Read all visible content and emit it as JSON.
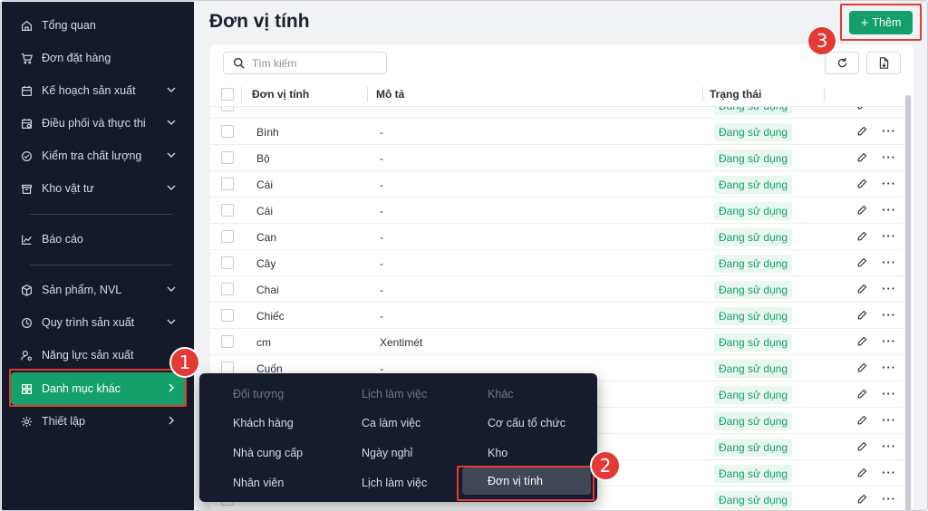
{
  "sidebar": {
    "items": [
      {
        "label": "Tổng quan",
        "icon": "home-icon"
      },
      {
        "label": "Đơn đặt hàng",
        "icon": "cart-icon"
      },
      {
        "label": "Kế hoạch sản xuất",
        "icon": "calendar-plan-icon"
      },
      {
        "label": "Điều phối và thực thi",
        "icon": "calendar-run-icon"
      },
      {
        "label": "Kiểm tra chất lượng",
        "icon": "check-circle-icon"
      },
      {
        "label": "Kho vật tư",
        "icon": "warehouse-icon"
      },
      {
        "label": "Báo cáo",
        "icon": "chart-icon"
      },
      {
        "label": "Sản phẩm, NVL",
        "icon": "box-icon"
      },
      {
        "label": "Quy trình sản xuất",
        "icon": "process-icon"
      },
      {
        "label": "Năng lực sản xuất",
        "icon": "capacity-icon"
      },
      {
        "label": "Danh mục khác",
        "icon": "grid-icon"
      },
      {
        "label": "Thiết lập",
        "icon": "gear-icon"
      }
    ]
  },
  "callouts": {
    "one": "1",
    "two": "2",
    "three": "3"
  },
  "header": {
    "title": "Đơn vị tính",
    "add_label": "Thêm"
  },
  "toolbar": {
    "search_placeholder": "Tìm kiếm"
  },
  "table": {
    "headers": {
      "name": "Đơn vị tính",
      "desc": "Mô tả",
      "status": "Trạng thái"
    },
    "rows": [
      {
        "name": "",
        "desc": "",
        "status": "Đang sử dụng"
      },
      {
        "name": "Bình",
        "desc": "-",
        "status": "Đang sử dụng"
      },
      {
        "name": "Bộ",
        "desc": "-",
        "status": "Đang sử dụng"
      },
      {
        "name": "Cái",
        "desc": "-",
        "status": "Đang sử dụng"
      },
      {
        "name": "Cái",
        "desc": "-",
        "status": "Đang sử dụng"
      },
      {
        "name": "Can",
        "desc": "-",
        "status": "Đang sử dụng"
      },
      {
        "name": "Cây",
        "desc": "-",
        "status": "Đang sử dụng"
      },
      {
        "name": "Chai",
        "desc": "-",
        "status": "Đang sử dụng"
      },
      {
        "name": "Chiếc",
        "desc": "-",
        "status": "Đang sử dụng"
      },
      {
        "name": "cm",
        "desc": "Xentimét",
        "status": "Đang sử dụng"
      },
      {
        "name": "Cuốn",
        "desc": "-",
        "status": "Đang sử dụng"
      },
      {
        "name": "",
        "desc": "",
        "status": "Đang sử dụng"
      },
      {
        "name": "",
        "desc": "",
        "status": "Đang sử dụng"
      },
      {
        "name": "",
        "desc": "",
        "status": "Đang sử dụng"
      },
      {
        "name": "",
        "desc": "",
        "status": "Đang sử dụng"
      },
      {
        "name": "",
        "desc": "",
        "status": "Đang sử dụng"
      }
    ]
  },
  "dropdown": {
    "columns": [
      {
        "header": "Đối tượng",
        "items": [
          "Khách hàng",
          "Nhà cung cấp",
          "Nhân viên"
        ]
      },
      {
        "header": "Lịch làm việc",
        "items": [
          "Ca làm việc",
          "Ngày nghỉ",
          "Lịch làm việc"
        ]
      },
      {
        "header": "Khác",
        "items": [
          "Cơ cấu tổ chức",
          "Kho",
          "Đơn vị tính"
        ]
      }
    ]
  },
  "colors": {
    "accent": "#14a06b",
    "sidebar_bg": "#141a2a",
    "callout": "#e53935"
  }
}
